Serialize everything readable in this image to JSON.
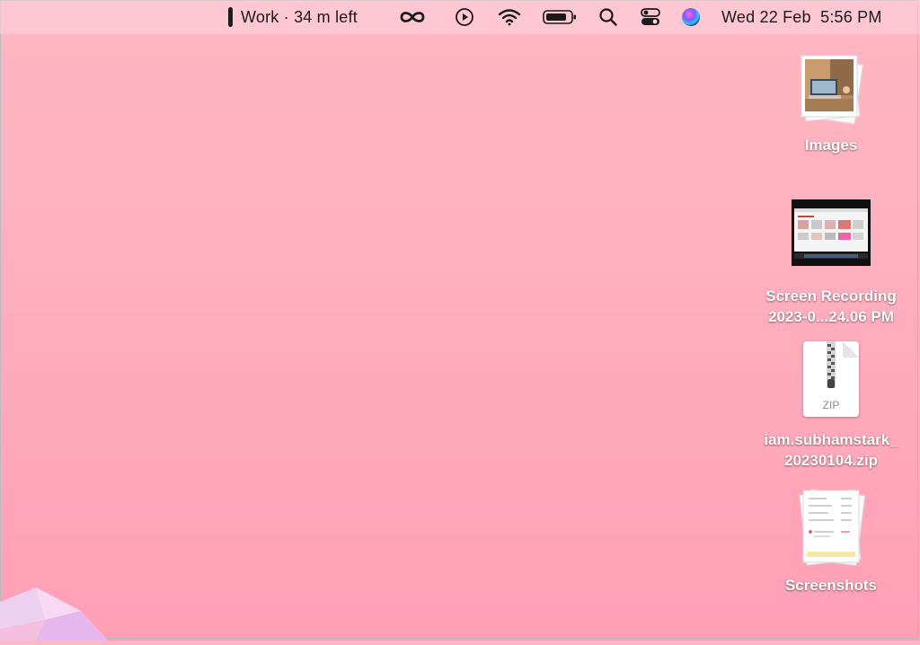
{
  "menubar": {
    "focus_label": "Work · 34 m left",
    "clock": "Wed 22 Feb  5:56 PM",
    "icons": [
      "focus-bar-icon",
      "infinity-icon",
      "play-circle-icon",
      "wifi-icon",
      "battery-icon",
      "search-icon",
      "control-center-icon",
      "siri-icon"
    ]
  },
  "desktop": {
    "items": [
      {
        "label_line1": "Images",
        "label_line2": "",
        "kind": "folder-stack"
      },
      {
        "label_line1": "Screen Recording",
        "label_line2": "2023-0...24.06 PM",
        "kind": "video"
      },
      {
        "label_line1": "iam.subhamstark_",
        "label_line2": "20230104.zip",
        "kind": "zip",
        "badge": "ZIP"
      },
      {
        "label_line1": "Screenshots",
        "label_line2": "",
        "kind": "folder-stack"
      }
    ]
  },
  "colors": {
    "wallpaper_top": "#ffb7c2",
    "wallpaper_bottom": "#ff9fb7",
    "menubar_text": "#1a1a1a"
  }
}
